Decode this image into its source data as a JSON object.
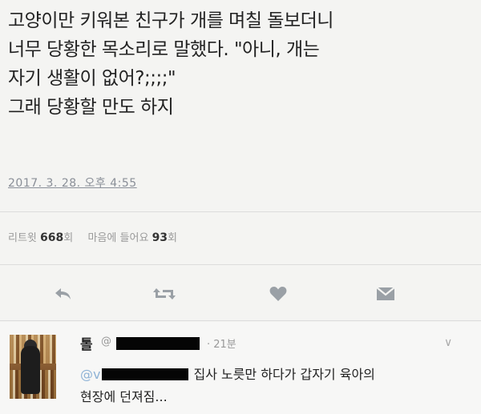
{
  "tweet": {
    "lines": [
      "고양이만 키워본 친구가 개를 며칠 돌보더니",
      "너무 당황한 목소리로 말했다. \"아니, 개는",
      "자기 생활이 없어?;;;;\"",
      "그래 당황할 만도 하지"
    ],
    "timestamp": "2017. 3. 28. 오후 4:55"
  },
  "stats": {
    "retweet_label": "리트윗",
    "retweet_count": "668",
    "retweet_unit": "회",
    "like_label": "마음에 들어요",
    "like_count": "93",
    "like_unit": "회"
  },
  "actions": [
    {
      "name": "reply",
      "icon": "reply-icon"
    },
    {
      "name": "retweet",
      "icon": "retweet-icon"
    },
    {
      "name": "like",
      "icon": "heart-icon"
    },
    {
      "name": "message",
      "icon": "envelope-icon"
    }
  ],
  "reply": {
    "name": "톨",
    "handle_prefix": "@",
    "time": "· 21분",
    "mention_prefix": "@v",
    "text_line1": "집사 노릇만 하다가 갑자기 육아의",
    "text_line2": "현장에 던져짐..."
  },
  "colors": {
    "background": "#f4f4f2",
    "icon": "#9aa0a6",
    "link": "#8fb3d6"
  }
}
